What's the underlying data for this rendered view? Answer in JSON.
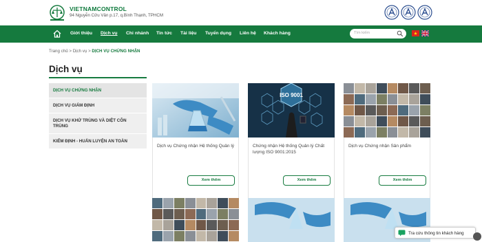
{
  "header": {
    "brand_name": "VIETNAMCONTROL",
    "brand_address": "94 Nguyễn Cửu Vân p.17, q.Bình Thạnh, TPHCM",
    "accent_color": "#157a3e"
  },
  "nav": {
    "items": [
      "Giới thiệu",
      "Dịch vụ",
      "Chi nhánh",
      "Tin tức",
      "Tài liệu",
      "Tuyển dụng",
      "Liên hệ",
      "Khách hàng"
    ],
    "active_index": 1,
    "search_placeholder": "Tìm kiếm"
  },
  "breadcrumb": {
    "home": "Trang chủ",
    "sep": " > ",
    "parent": "Dịch vụ",
    "current": "DỊCH VỤ CHỨNG NHẬN"
  },
  "page_title": "Dịch vụ",
  "sidebar": {
    "items": [
      {
        "label": "DỊCH VỤ CHỨNG NHẬN"
      },
      {
        "label": "DỊCH VỤ GIÁM ĐỊNH"
      },
      {
        "label": "DỊCH VỤ KHỬ TRÙNG VÀ DIỆT CÔN TRÙNG"
      },
      {
        "label": "KIỂM ĐỊNH - HUẤN LUYỆN AN TOÀN"
      }
    ]
  },
  "cards": [
    {
      "title": "Dịch vụ Chứng nhận Hệ thống Quản lý",
      "button": "Xem thêm",
      "image": "lab-flask-image"
    },
    {
      "title": "Chứng nhận Hệ thống Quản lý Chất lượng ISO 9001:2015",
      "button": "Xem thêm",
      "image": "iso-9001-image"
    },
    {
      "title": "Dịch vụ Chứng nhận Sản phẩm",
      "button": "Xem thêm",
      "image": "product-mosaic-image"
    }
  ],
  "iso_text": "ISO 9001",
  "chat": {
    "label": "Tra cứu thông tin khách hàng"
  }
}
